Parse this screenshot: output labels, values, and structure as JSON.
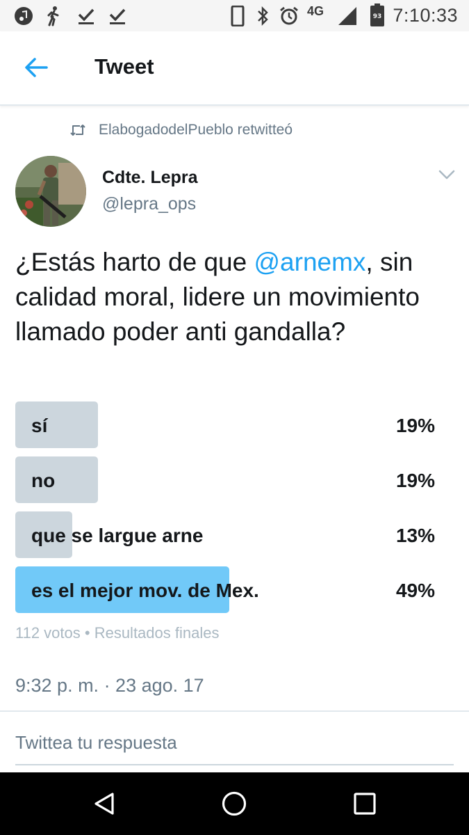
{
  "status_bar": {
    "time": "7:10:33",
    "network": "4G",
    "battery_level": "93",
    "icons": [
      "music-icon",
      "hiker-icon",
      "download-check-icon",
      "download-check-icon",
      "phone-icon",
      "bluetooth-icon",
      "alarm-icon",
      "signal-icon",
      "battery-icon"
    ]
  },
  "app_bar": {
    "title": "Tweet",
    "back_icon": "arrow-left-icon"
  },
  "retweet": {
    "icon": "retweet-icon",
    "text": "ElabogadodelPueblo retwitteó"
  },
  "author": {
    "name": "Cdte. Lepra",
    "handle": "@lepra_ops",
    "menu_icon": "chevron-down-icon"
  },
  "tweet": {
    "text_before": "¿Estás harto de que ",
    "mention": "@arnemx",
    "text_after": ", sin calidad moral, lidere un movimiento llamado poder anti gandalla?"
  },
  "poll": {
    "options": [
      {
        "label": "sí",
        "percent_text": "19%",
        "fraction": 0.19
      },
      {
        "label": "no",
        "percent_text": "19%",
        "fraction": 0.19
      },
      {
        "label": "que se largue arne",
        "percent_text": "13%",
        "fraction": 0.13
      },
      {
        "label": "es el mejor mov. de Mex.",
        "percent_text": "49%",
        "fraction": 0.49,
        "winner": true
      }
    ],
    "meta": "112 votos • Resultados finales"
  },
  "timestamp": "9:32 p. m. · 23 ago. 17",
  "reply": {
    "placeholder": "Twittea tu respuesta"
  },
  "nav_bar": {
    "icons": [
      "back-triangle-icon",
      "home-circle-icon",
      "recents-square-icon"
    ]
  },
  "colors": {
    "accent": "#1da1f2",
    "poll_bar": "#ccd6dd",
    "poll_bar_winner": "#71c9f8",
    "secondary_text": "#657786"
  }
}
